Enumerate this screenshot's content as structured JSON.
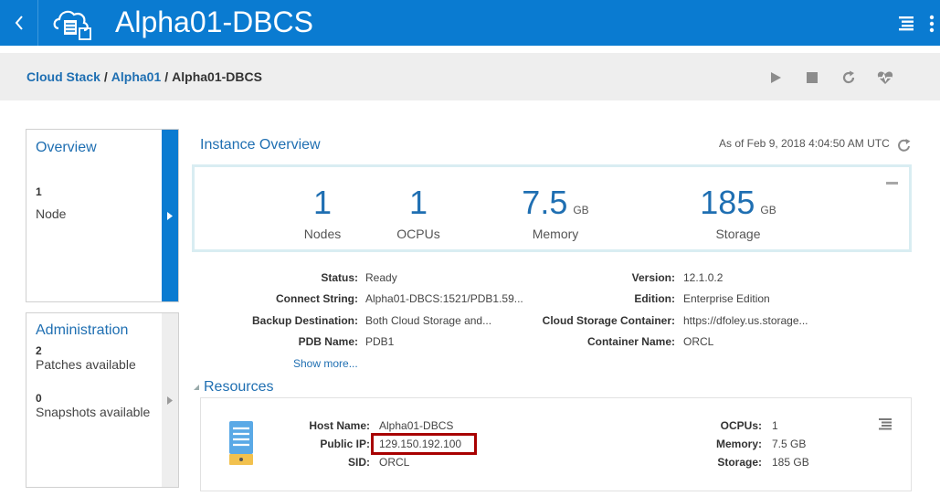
{
  "header": {
    "title": "Alpha01-DBCS",
    "back_icon": "chevron-left-icon",
    "app_icon": "cloud-database-icon",
    "menu_icon": "hamburger-menu-icon",
    "more_icon": "kebab-menu-icon"
  },
  "breadcrumb": {
    "items": [
      "Cloud Stack",
      "Alpha01",
      "Alpha01-DBCS"
    ],
    "separator": "/"
  },
  "actions": [
    "start-icon",
    "stop-icon",
    "restart-icon",
    "health-icon"
  ],
  "overview_card": {
    "title": "Overview",
    "count": "1",
    "label": "Node"
  },
  "admin_card": {
    "title": "Administration",
    "patches_count": "2",
    "patches_label": "Patches available",
    "snapshots_count": "0",
    "snapshots_label": "Snapshots available"
  },
  "instance_overview": {
    "title": "Instance Overview",
    "as_of": "As of Feb 9, 2018 4:04:50 AM UTC",
    "metrics": [
      {
        "value": "1",
        "unit": "",
        "label": "Nodes"
      },
      {
        "value": "1",
        "unit": "",
        "label": "OCPUs"
      },
      {
        "value": "7.5",
        "unit": "GB",
        "label": "Memory"
      },
      {
        "value": "185",
        "unit": "GB",
        "label": "Storage"
      }
    ]
  },
  "details": {
    "left": [
      {
        "label": "Status:",
        "value": "Ready"
      },
      {
        "label": "Connect String:",
        "value": "Alpha01-DBCS:1521/PDB1.59..."
      },
      {
        "label": "Backup Destination:",
        "value": "Both Cloud Storage and..."
      },
      {
        "label": "PDB Name:",
        "value": "PDB1"
      }
    ],
    "right": [
      {
        "label": "Version:",
        "value": "12.1.0.2"
      },
      {
        "label": "Edition:",
        "value": "Enterprise Edition"
      },
      {
        "label": "Cloud Storage Container:",
        "value": "https://dfoley.us.storage..."
      },
      {
        "label": "Container Name:",
        "value": "ORCL"
      }
    ],
    "show_more": "Show more..."
  },
  "resources": {
    "title": "Resources",
    "left": [
      {
        "label": "Host Name:",
        "value": "Alpha01-DBCS"
      },
      {
        "label": "Public IP:",
        "value": "129.150.192.100"
      },
      {
        "label": "SID:",
        "value": "ORCL"
      }
    ],
    "right": [
      {
        "label": "OCPUs:",
        "value": "1"
      },
      {
        "label": "Memory:",
        "value": "7.5 GB"
      },
      {
        "label": "Storage:",
        "value": "185 GB"
      }
    ]
  },
  "colors": {
    "header_bg": "#0a7bd1",
    "link": "#1f6fb2",
    "highlight_border": "#a80000",
    "server_icon": "#5aa9e6",
    "server_accent": "#f2c14e"
  }
}
